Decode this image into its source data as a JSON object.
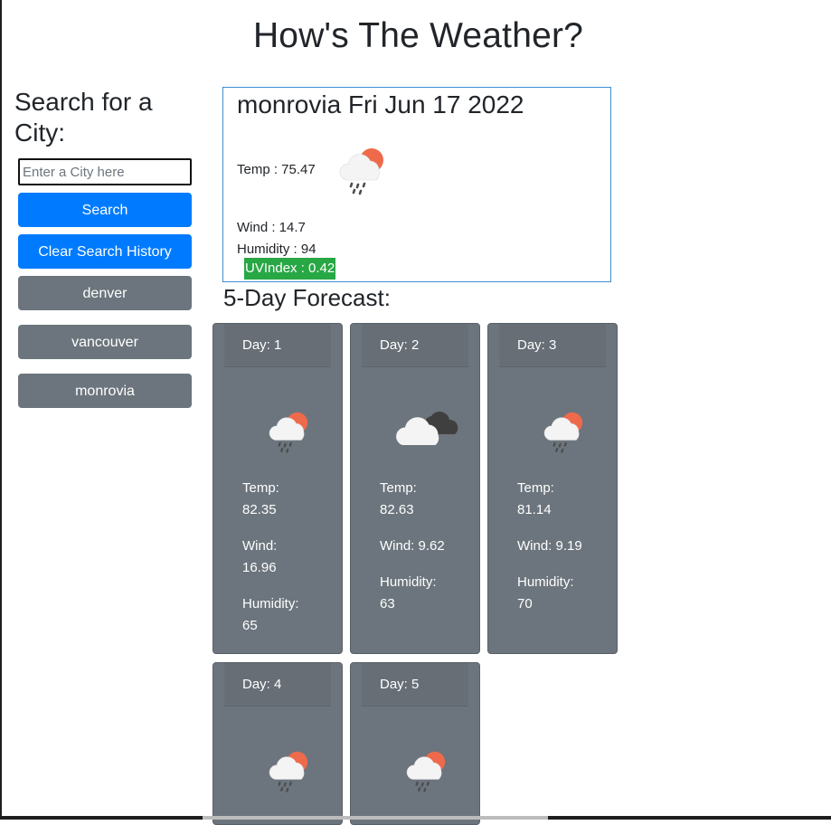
{
  "page": {
    "title": "How's The Weather?"
  },
  "search": {
    "heading": "Search for a City:",
    "input_placeholder": "Enter a City here",
    "input_value": "",
    "search_label": "Search",
    "clear_label": "Clear Search History",
    "history": [
      "denver",
      "vancouver",
      "monrovia"
    ]
  },
  "current": {
    "title": "monrovia Fri Jun 17 2022",
    "temp": "Temp : 75.47",
    "wind": "Wind : 14.7",
    "humidity": "Humidity : 94",
    "uv": "UVIndex : 0.42",
    "icon": "rain-sun-icon"
  },
  "forecast": {
    "heading": "5-Day Forecast:",
    "days": [
      {
        "day": "Day: 1",
        "icon": "rain-sun-icon",
        "temp_label": "Temp:",
        "temp": "82.35",
        "wind_label": "Wind:",
        "wind": "16.96",
        "humidity_label": "Humidity:",
        "humidity": "65"
      },
      {
        "day": "Day: 2",
        "icon": "dark-clouds-icon",
        "temp_label": "Temp:",
        "temp": "82.63",
        "wind": "Wind: 9.62",
        "humidity_label": "Humidity:",
        "humidity": "63"
      },
      {
        "day": "Day: 3",
        "icon": "rain-sun-icon",
        "temp_label": "Temp:",
        "temp": "81.14",
        "wind": "Wind: 9.19",
        "humidity_label": "Humidity:",
        "humidity": "70"
      },
      {
        "day": "Day: 4",
        "icon": "rain-sun-icon"
      },
      {
        "day": "Day: 5",
        "icon": "rain-sun-icon"
      }
    ]
  },
  "colors": {
    "primary": "#007bff",
    "secondary": "#6c757d",
    "uv_badge": "#28a745",
    "card_border": "#3e8ed0",
    "sun": "#ef6a4a"
  }
}
